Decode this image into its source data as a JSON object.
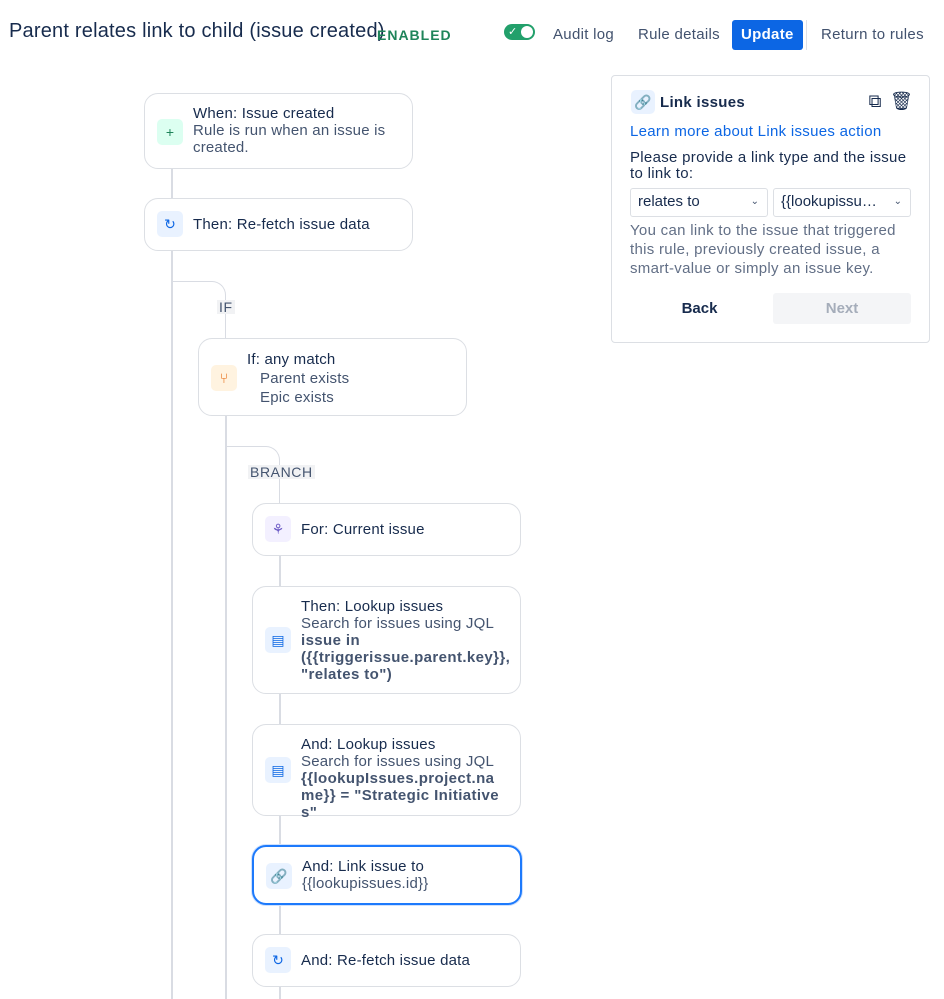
{
  "header": {
    "title": "Parent relates link to child (issue created)",
    "status": "ENABLED",
    "toggle_check": "✓",
    "audit_log": "Audit log",
    "rule_details": "Rule details",
    "update": "Update",
    "return": "Return to rules"
  },
  "flow": {
    "trigger": {
      "icon": "plus-icon",
      "glyph": "+",
      "title": "When: Issue created",
      "desc": "Rule is run when an issue is created."
    },
    "refetch1": {
      "icon": "refresh-icon",
      "glyph": "↻",
      "title": "Then: Re-fetch issue data"
    },
    "if_label": "IF",
    "condition": {
      "icon": "branch-condition-icon",
      "glyph": "⑂",
      "title": "If: any match",
      "items": [
        "Parent exists",
        "Epic exists"
      ]
    },
    "branch_label": "BRANCH",
    "for_current": {
      "icon": "hierarchy-icon",
      "glyph": "⚘",
      "title": "For: Current issue"
    },
    "lookup1": {
      "icon": "lookup-icon",
      "glyph": "▤",
      "title": "Then: Lookup issues",
      "desc": "Search for issues using JQL",
      "jql": "issue in ({{triggerissue.parent.key}}, \"relates to\")"
    },
    "lookup2": {
      "icon": "lookup-icon",
      "glyph": "▤",
      "title": "And: Lookup issues",
      "desc": "Search for issues using JQL",
      "jql": "{{lookupIssues.project.name}} = \"Strategic Initiatives\""
    },
    "link": {
      "icon": "link-icon",
      "glyph": "🔗",
      "title": "And: Link issue to",
      "desc": "{{lookupissues.id}}"
    },
    "refetch2": {
      "icon": "refresh-icon",
      "glyph": "↻",
      "title": "And: Re-fetch issue data"
    }
  },
  "panel": {
    "icon": "link-icon",
    "title": "Link issues",
    "copy_glyph": "⧉",
    "delete_glyph": "🗑",
    "learn_more": "Learn more about Link issues action",
    "instruction": "Please provide a link type and the issue to link to:",
    "link_type": "relates to",
    "issue_value": "{{lookupissu…",
    "help": "You can link to the issue that triggered this rule, previously created issue, a smart-value or simply an issue key.",
    "back": "Back",
    "next": "Next"
  },
  "colors": {
    "primary": "#0c66e4",
    "enabled": "#1f845a",
    "selected_border": "#1d7afc"
  }
}
